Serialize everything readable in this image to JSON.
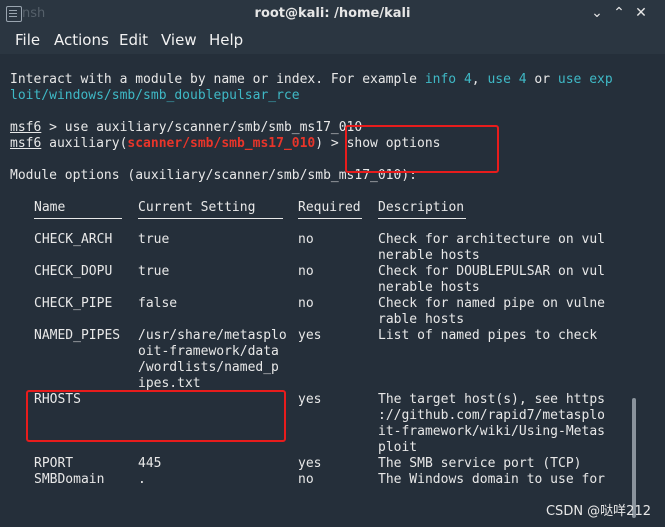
{
  "window": {
    "title": "root@kali: /home/kali",
    "ghost_tab": "nsh",
    "minimize": "⌄",
    "restore": "⌃",
    "close": "✕"
  },
  "menu": [
    "File",
    "Actions",
    "Edit",
    "View",
    "Help"
  ],
  "terminal": {
    "intro_1_pre": "Interact with a module by name or index. For example ",
    "intro_1_c1": "info 4",
    "intro_1_sep1": ", ",
    "intro_1_c2": "use 4",
    "intro_1_sep2": " or ",
    "intro_1_c3": "use exp",
    "intro_2": "loit/windows/smb/smb_doublepulsar_rce",
    "prompt1_msf": "msf6",
    "prompt1_rest": " > use auxiliary/scanner/smb/smb_ms17_010",
    "prompt2_msf": "msf6",
    "prompt2_a": " auxiliary(",
    "prompt2_mod": "scanner/smb/smb_ms17_010",
    "prompt2_b": ") > ",
    "prompt2_cmd": "show options",
    "module_options": "Module options (auxiliary/scanner/smb/smb_ms17_010):",
    "headers": [
      "Name",
      "Current Setting",
      "Required",
      "Description"
    ],
    "rows": [
      {
        "name": "CHECK_ARCH",
        "setting": [
          "true"
        ],
        "required": "no",
        "desc": [
          "Check for architecture on vul",
          "nerable hosts"
        ]
      },
      {
        "name": "CHECK_DOPU",
        "setting": [
          "true"
        ],
        "required": "no",
        "desc": [
          "Check for DOUBLEPULSAR on vul",
          "nerable hosts"
        ]
      },
      {
        "name": "CHECK_PIPE",
        "setting": [
          "false"
        ],
        "required": "no",
        "desc": [
          "Check for named pipe on vulne",
          "rable hosts"
        ]
      },
      {
        "name": "NAMED_PIPES",
        "setting": [
          "/usr/share/metasplo",
          "oit-framework/data",
          "/wordlists/named_p",
          "ipes.txt"
        ],
        "required": "yes",
        "desc": [
          "List of named pipes to check"
        ]
      },
      {
        "name": "RHOSTS",
        "setting": [
          ""
        ],
        "required": "yes",
        "desc": [
          "The target host(s), see https",
          "://github.com/rapid7/metasplo",
          "it-framework/wiki/Using-Metas",
          "ploit"
        ]
      },
      {
        "name": "RPORT",
        "setting": [
          "445"
        ],
        "required": "yes",
        "desc": [
          "The SMB service port (TCP)"
        ]
      },
      {
        "name": "SMBDomain",
        "setting": [
          "."
        ],
        "required": "no",
        "desc": [
          "The Windows domain to use for"
        ]
      }
    ]
  },
  "watermark": "CSDN @哒咩212"
}
